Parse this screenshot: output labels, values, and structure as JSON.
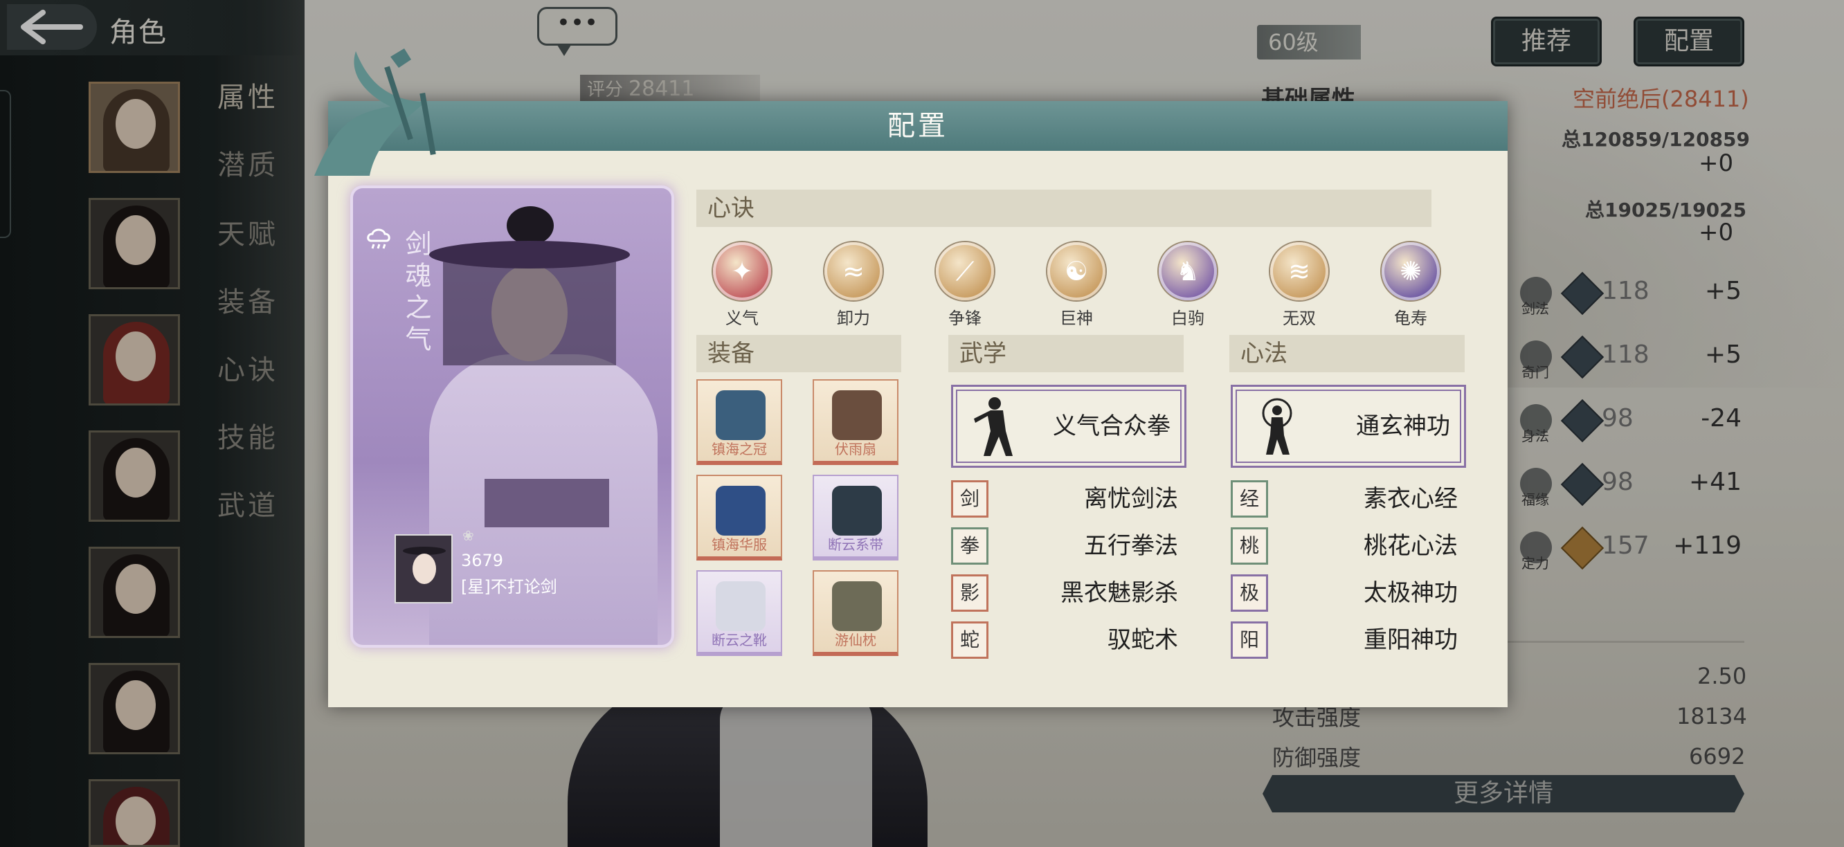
{
  "window": {
    "title": "角色"
  },
  "sidebar": {
    "menu": [
      "属性",
      "潜质",
      "天赋",
      "装备",
      "心诀",
      "技能",
      "武道"
    ],
    "active_index": 0
  },
  "header": {
    "level": "60级",
    "recommend_label": "推荐",
    "config_label": "配置",
    "chat_glyph": "•••"
  },
  "score": {
    "label": "评分",
    "value": "28411"
  },
  "attributes": {
    "base_label": "基础属性",
    "rank_text": "空前绝后(28411)",
    "hp_total": "总120859/120859",
    "hp_delta": "+0",
    "mp_total": "总19025/19025",
    "mp_delta": "+0",
    "rows": [
      {
        "label": "剑法",
        "value": "118",
        "delta": "+5",
        "gem": "blue"
      },
      {
        "label": "奇门",
        "value": "118",
        "delta": "+5",
        "gem": "blue"
      },
      {
        "label": "身法",
        "value": "98",
        "delta": "-24",
        "gem": "blue"
      },
      {
        "label": "福缘",
        "value": "98",
        "delta": "+41",
        "gem": "blue"
      },
      {
        "label": "定力",
        "value": "157",
        "delta": "+119",
        "gem": "gold"
      }
    ],
    "bottom": [
      {
        "label": "",
        "value": "2.50"
      },
      {
        "label": "攻击强度",
        "value": "18134"
      },
      {
        "label": "防御强度",
        "value": "6692"
      }
    ],
    "more_label": "更多详情"
  },
  "modal": {
    "title": "配置",
    "character": {
      "title_vertical": "剑魂之气",
      "weather_icon": "cloud-rain-icon",
      "score": "3679",
      "name": "[星]不打论剑"
    },
    "xinjue": {
      "label": "心诀",
      "items": [
        {
          "name": "义气",
          "glyph": "✦",
          "color": "#c0555b"
        },
        {
          "name": "卸力",
          "glyph": "≈",
          "color": "#c79a5e"
        },
        {
          "name": "争锋",
          "glyph": "⟋",
          "color": "#c79a5e"
        },
        {
          "name": "巨神",
          "glyph": "☯",
          "color": "#c79a5e"
        },
        {
          "name": "白驹",
          "glyph": "♞",
          "color": "#7b5ea8"
        },
        {
          "name": "无双",
          "glyph": "≋",
          "color": "#c79a5e"
        },
        {
          "name": "龟寿",
          "glyph": "✺",
          "color": "#6a55a3"
        }
      ]
    },
    "equipment": {
      "label": "装备",
      "items": [
        {
          "name": "镇海之冠",
          "tier": "red",
          "art": "#3b5f7d"
        },
        {
          "name": "伏雨扇",
          "tier": "red",
          "art": "#6a4e3e"
        },
        {
          "name": "镇海华服",
          "tier": "red",
          "art": "#2f4f86"
        },
        {
          "name": "断云系带",
          "tier": "purple",
          "art": "#2d3b47"
        },
        {
          "name": "断云之靴",
          "tier": "purple",
          "art": "#d7d9e4"
        },
        {
          "name": "游仙枕",
          "tier": "red",
          "art": "#6d6b57"
        }
      ]
    },
    "wuxue": {
      "label": "武学",
      "main": "义气合众拳",
      "list": [
        {
          "name": "离忧剑法",
          "tier": "red",
          "glyph": "剑"
        },
        {
          "name": "五行拳法",
          "tier": "green",
          "glyph": "拳"
        },
        {
          "name": "黑衣魅影杀",
          "tier": "red",
          "glyph": "影"
        },
        {
          "name": "驭蛇术",
          "tier": "red",
          "glyph": "蛇"
        }
      ]
    },
    "xinfa": {
      "label": "心法",
      "main": "通玄神功",
      "list": [
        {
          "name": "素衣心经",
          "tier": "green",
          "glyph": "经"
        },
        {
          "name": "桃花心法",
          "tier": "green",
          "glyph": "桃"
        },
        {
          "name": "太极神功",
          "tier": "purple",
          "glyph": "极"
        },
        {
          "name": "重阳神功",
          "tier": "purple",
          "glyph": "阳"
        }
      ]
    }
  },
  "colors": {
    "modal_header": "#5a8686",
    "purple_tier": "#8870a5",
    "red_tier": "#c0735c",
    "rank_text": "#c96a4c"
  }
}
